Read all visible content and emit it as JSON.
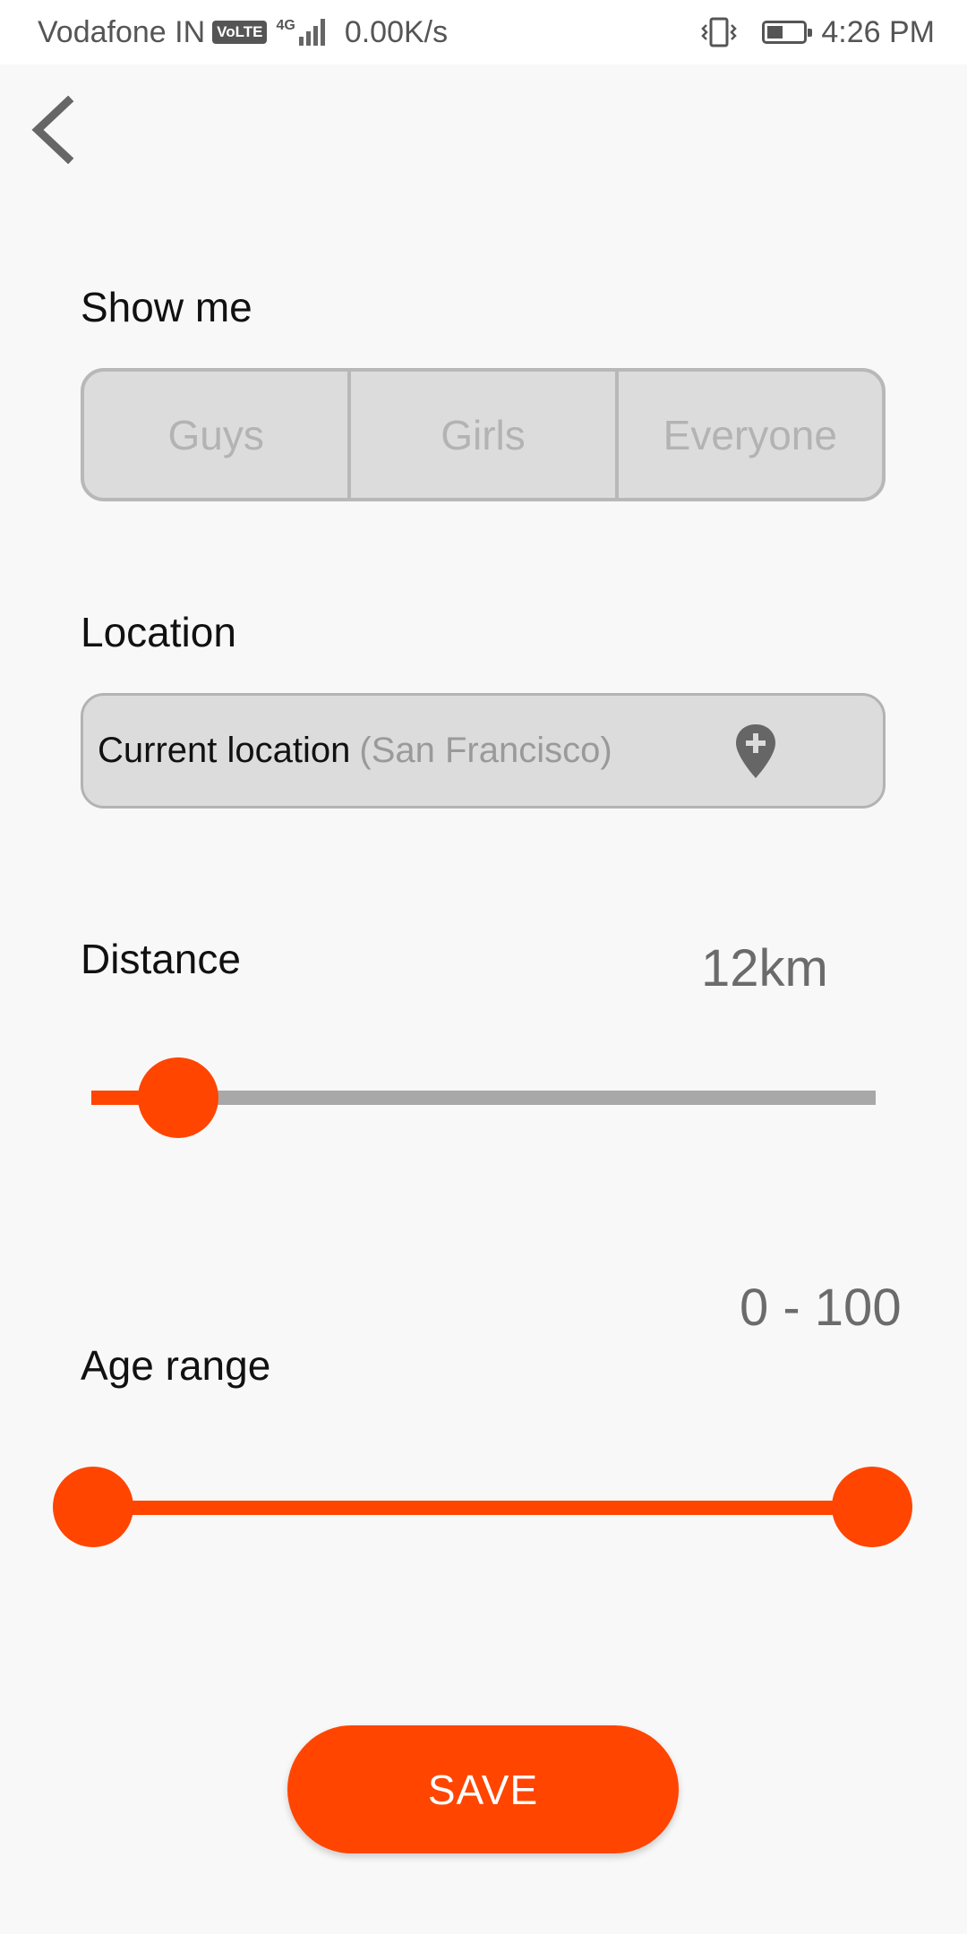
{
  "status_bar": {
    "carrier": "Vodafone IN",
    "volte": "VoLTE",
    "network": "4G",
    "speed": "0.00K/s",
    "time": "4:26 PM",
    "battery_level": 0.45,
    "icons": [
      "signal-icon",
      "vibrate-icon",
      "battery-icon"
    ]
  },
  "header": {
    "back_icon": "chevron-left-icon"
  },
  "show_me": {
    "label": "Show me",
    "options": [
      "Guys",
      "Girls",
      "Everyone"
    ]
  },
  "location": {
    "label": "Location",
    "current": "Current location",
    "city": "(San Francisco)",
    "icon": "add-location-pin-icon"
  },
  "distance": {
    "label": "Distance",
    "value_text": "12km",
    "value": 12,
    "min": 0,
    "max": 100
  },
  "age_range": {
    "label": "Age range",
    "value_text": "0 - 100",
    "low": 0,
    "high": 100,
    "min": 0,
    "max": 100
  },
  "save": {
    "label": "SAVE"
  },
  "colors": {
    "accent": "#ff4500",
    "track_inactive": "#a8a8a8",
    "field_bg": "#dcdcdc",
    "background": "#f8f8f8"
  }
}
